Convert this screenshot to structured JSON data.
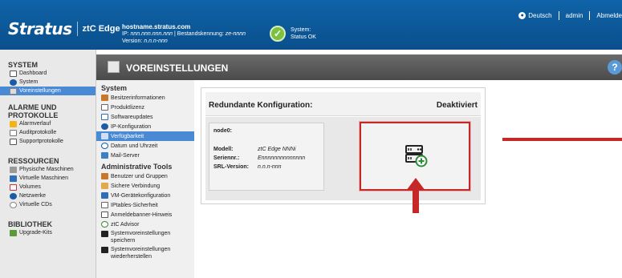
{
  "header": {
    "brand": "Stratus",
    "product": "ztC Edge",
    "hostname": "hostname.stratus.com",
    "ip_line_prefix": "IP: ",
    "ip_value": "nnn.nnn.nnn.nnn",
    "asset_label": " | Bestandskennung: ",
    "asset_value": "ze-nnnn",
    "version_label": "Version: ",
    "version_value": "n.n.n-nnn",
    "status_label": "System:",
    "status_value": "Status OK"
  },
  "topnav": {
    "language": "Deutsch",
    "user": "admin",
    "logout": "Abmelde"
  },
  "leftnav": {
    "system_title": "SYSTEM",
    "system_items": [
      "Dashboard",
      "System",
      "Voreinstellungen"
    ],
    "alarms_title_1": "ALARME UND",
    "alarms_title_2": "PROTOKOLLE",
    "alarms_items": [
      "Alarmverlauf",
      "Auditprotokolle",
      "Supportprotokolle"
    ],
    "resources_title": "RESSOURCEN",
    "resources_items": [
      "Physische Maschinen",
      "Virtuelle Maschinen",
      "Volumes",
      "Netzwerke",
      "Virtuelle CDs"
    ],
    "library_title": "BIBLIOTHEK",
    "library_items": [
      "Upgrade-Kits"
    ]
  },
  "page": {
    "title": "VOREINSTELLUNGEN"
  },
  "subnav": {
    "system_title": "System",
    "system_items": [
      "Besitzerinformationen",
      "Produktlizenz",
      "Softwareupdates",
      "IP-Konfiguration",
      "Verfügbarkeit",
      "Datum und Uhrzeit",
      "Mail-Server"
    ],
    "admin_title": "Administrative Tools",
    "admin_items": [
      "Benutzer und Gruppen",
      "Sichere Verbindung",
      "VM-Gerätekonfiguration",
      "IPtables-Sicherheit",
      "Anmeldebanner-Hinweis",
      "ztC Advisor"
    ],
    "save_1": "Systemvoreinstellungen",
    "save_2": "speichern",
    "restore_1": "Systemvoreinstellungen",
    "restore_2": "wiederherstellen"
  },
  "panel": {
    "label": "Redundante Konfiguration:",
    "value": "Deaktiviert",
    "node": {
      "name": "node0:",
      "model_label": "Modell:",
      "model_value": "ztC Edge NNNi",
      "serial_label": "Seriennr.:",
      "serial_value": "Ennnnnnnnnnnnnn",
      "srl_label": "SRL-Version:",
      "srl_value": "n.n.n-nnn"
    }
  },
  "colors": {
    "header_blue": "#0a4f8c",
    "accent_blue": "#4a89d4",
    "status_green": "#7cc142",
    "highlight_red": "#c62828"
  }
}
